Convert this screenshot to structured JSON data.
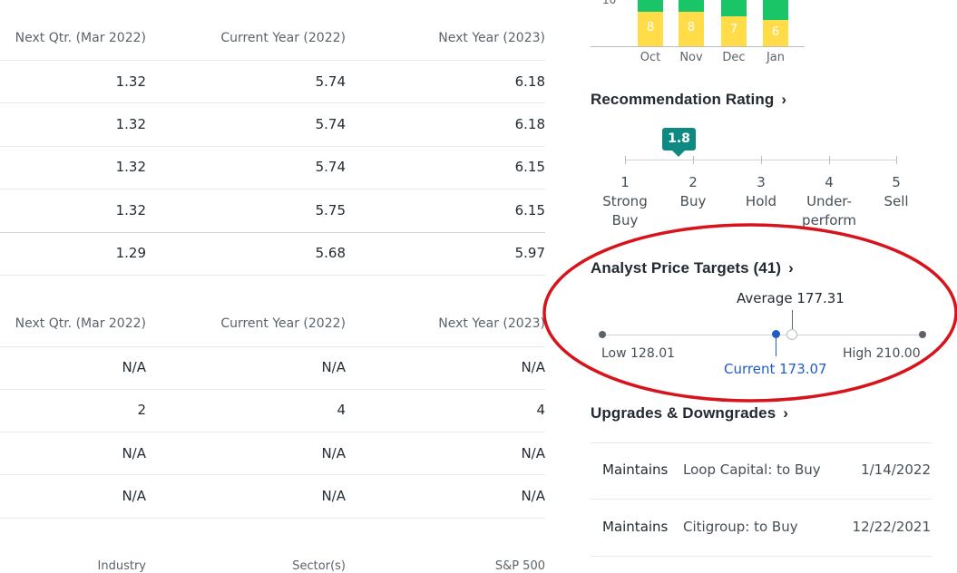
{
  "table1": {
    "headers": [
      "Next Qtr. (Mar 2022)",
      "Current Year (2022)",
      "Next Year (2023)"
    ],
    "rows": [
      [
        "1.32",
        "5.74",
        "6.18"
      ],
      [
        "1.32",
        "5.74",
        "6.18"
      ],
      [
        "1.32",
        "5.74",
        "6.15"
      ],
      [
        "1.32",
        "5.75",
        "6.15"
      ],
      [
        "1.29",
        "5.68",
        "5.97"
      ]
    ]
  },
  "table2": {
    "headers": [
      "Next Qtr. (Mar 2022)",
      "Current Year (2022)",
      "Next Year (2023)"
    ],
    "rows": [
      [
        "N/A",
        "N/A",
        "N/A"
      ],
      [
        "2",
        "4",
        "4"
      ],
      [
        "N/A",
        "N/A",
        "N/A"
      ],
      [
        "N/A",
        "N/A",
        "N/A"
      ]
    ]
  },
  "table3": {
    "headers": [
      "Industry",
      "Sector(s)",
      "S&P 500"
    ]
  },
  "trend_chart": {
    "y_label": "10",
    "months": [
      "Oct",
      "Nov",
      "Dec",
      "Jan"
    ],
    "yellow_values": [
      "8",
      "8",
      "7",
      "6"
    ],
    "colors": {
      "green": "#1ac567",
      "yellow": "#ffdc48",
      "red": "#e0515a"
    }
  },
  "recommendation": {
    "title": "Recommendation Rating",
    "value": "1.8",
    "value_numeric": 1.8,
    "scale": [
      {
        "num": "1",
        "label1": "Strong",
        "label2": "Buy"
      },
      {
        "num": "2",
        "label1": "Buy",
        "label2": ""
      },
      {
        "num": "3",
        "label1": "Hold",
        "label2": ""
      },
      {
        "num": "4",
        "label1": "Under-",
        "label2": "perform"
      },
      {
        "num": "5",
        "label1": "Sell",
        "label2": ""
      }
    ],
    "badge_color": "#0f8a82"
  },
  "price_targets": {
    "title": "Analyst Price Targets (41)",
    "average_label": "Average 177.31",
    "low_label": "Low 128.01",
    "high_label": "High 210.00",
    "current_label": "Current 173.07",
    "low": 128.01,
    "high": 210.0,
    "average": 177.31,
    "current": 173.07,
    "current_color": "#1e5cc6"
  },
  "upgrades": {
    "title": "Upgrades & Downgrades",
    "rows": [
      {
        "action": "Maintains",
        "firm": "Loop Capital: to Buy",
        "date": "1/14/2022"
      },
      {
        "action": "Maintains",
        "firm": "Citigroup: to Buy",
        "date": "12/22/2021"
      }
    ]
  },
  "annotation_color": "#d7141c"
}
